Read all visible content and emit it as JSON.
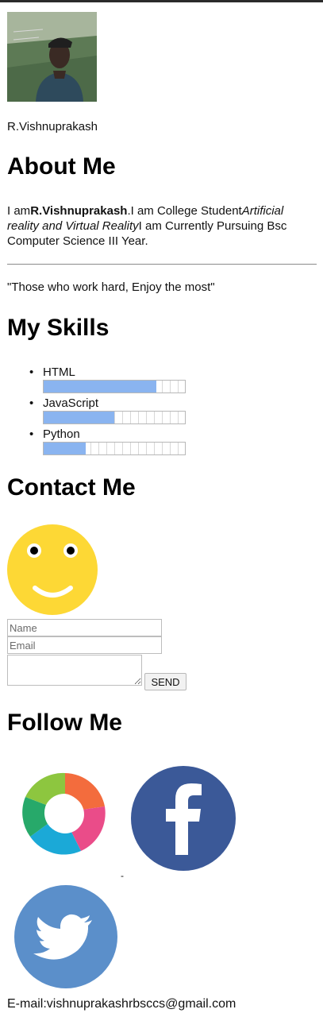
{
  "profile": {
    "name": "R.Vishnuprakash"
  },
  "about": {
    "heading": "About Me",
    "intro": "I am",
    "name_bold": "R.Vishnuprakash",
    "text_mid": ".I am College Student",
    "italic": "Artificial reality and Virtual Reality",
    "text_end": "I am Currently Pursuing Bsc Computer Science III Year."
  },
  "quote": "\"Those who work hard, Enjoy the most\"",
  "skills": {
    "heading": "My Skills",
    "items": [
      {
        "label": "HTML",
        "level": 0.8
      },
      {
        "label": "JavaScript",
        "level": 0.5
      },
      {
        "label": "Python",
        "level": 0.3
      }
    ],
    "bar_color": "#8ab4f0"
  },
  "contact": {
    "heading": "Contact Me",
    "name_placeholder": "Name",
    "email_placeholder": "Email",
    "send_label": "SEND"
  },
  "follow": {
    "heading": "Follow Me",
    "icons": [
      "sololearn-icon",
      "facebook-icon",
      "twitter-icon"
    ],
    "separator": "-"
  },
  "email": "E-mail:vishnuprakashrbsccs@gmail.com",
  "colors": {
    "smiley": "#fdd835",
    "facebook": "#3b5998",
    "twitter": "#5b8fca"
  }
}
